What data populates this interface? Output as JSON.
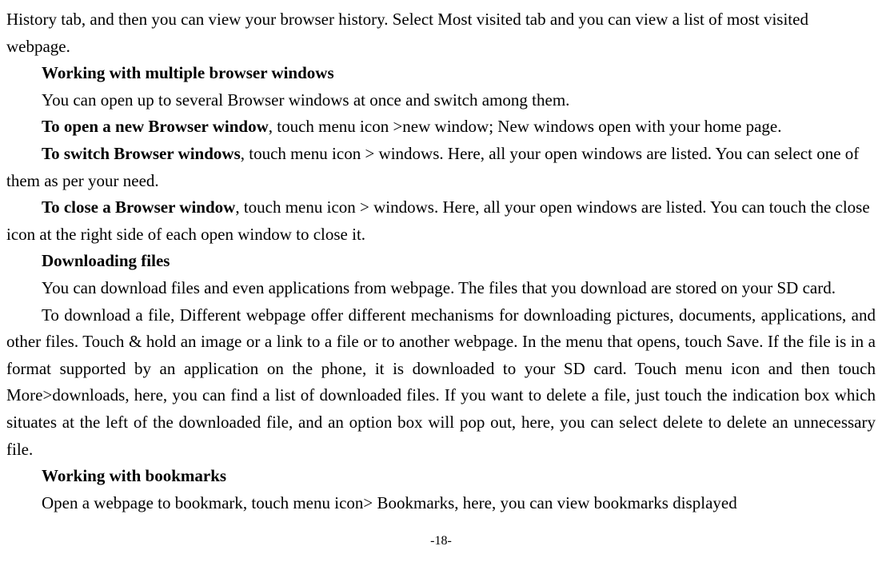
{
  "content": {
    "p1": "History tab, and then you can view your browser history. Select Most visited tab and you can view a list of most visited webpage.",
    "h1": "Working with multiple browser windows",
    "p2": "You can open up to several Browser windows at once and switch among them.",
    "b3": "To open a new Browser window",
    "p3": ", touch menu icon >new window; New windows open with your home page.",
    "b4": "To switch Browser windows",
    "p4a": ", touch menu icon > windows. Here, all your open windows are listed. ",
    "p4b": "You can select one of them as per your need.",
    "b5": "To close a Browser window",
    "p5a": ", touch menu icon > windows. Here, all your open windows are listed. ",
    "p5b": "You can touch the close icon at the right side of each open window to close it.",
    "h2": "Downloading files",
    "p6": "You can download files and even applications from webpage. The files that you download are stored on your SD card.",
    "p7": "To download a file, Different webpage offer different mechanisms for downloading pictures, documents, applications, and other files. Touch & hold an image or a link to a file or to another webpage. In the menu that opens, touch Save. If the file is in a format supported by an application on the phone, it is downloaded to your SD card. Touch menu icon and then touch More>downloads, here, you can find a list of downloaded files. If you want to delete a file, just touch the indication box which situates at the left of the downloaded file, and an option box will pop out, here, you can select delete to delete an unnecessary file.",
    "h3": "Working with bookmarks",
    "p8": "Open a webpage to bookmark, touch menu icon> Bookmarks, here, you can view bookmarks displayed",
    "pagenum": "-18-"
  }
}
